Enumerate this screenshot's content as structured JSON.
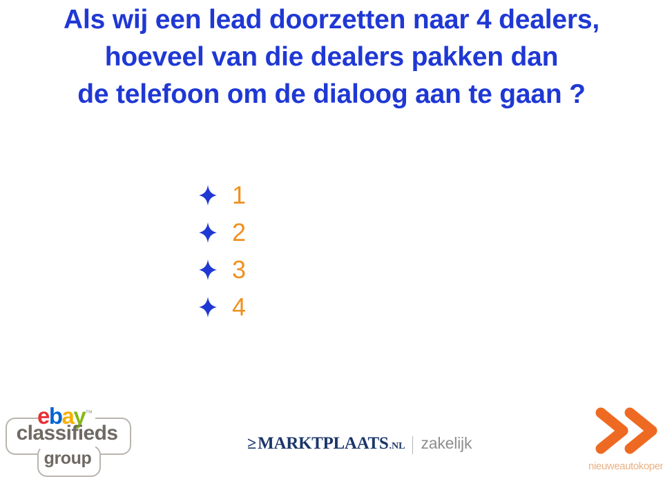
{
  "slide": {
    "background_color": "#ffffff",
    "title": {
      "color": "#1f38d4",
      "lines": [
        "Als wij een lead doorzetten naar 4 dealers,",
        "hoeveel van die dealers pakken dan",
        "de telefoon om de dialoog aan te gaan ?"
      ]
    },
    "bullets": {
      "marker_icon": "blue-four-point-star-bullet",
      "marker_color": "#1f38d4",
      "label_color": "#f0901f",
      "items": [
        {
          "label": "1"
        },
        {
          "label": "2"
        },
        {
          "label": "3"
        },
        {
          "label": "4"
        }
      ]
    },
    "footer": {
      "logos": [
        {
          "name": "ebay-classifieds-group",
          "ebay_letters": [
            {
              "char": "e",
              "color": "#e53238"
            },
            {
              "char": "b",
              "color": "#0064d2"
            },
            {
              "char": "a",
              "color": "#f5af02"
            },
            {
              "char": "y",
              "color": "#86b817"
            }
          ],
          "trademark": "™",
          "classifieds_text": "classifieds",
          "group_text": "group",
          "text_color": "#6e6a63",
          "outline_color": "#b9b5ad"
        },
        {
          "name": "marktplaats-zakelijk",
          "arrow_glyph": "≥",
          "wordmark": "MARKTPLAATS",
          "tld": ".NL",
          "separator": "|",
          "subtitle": "zakelijk",
          "wordmark_color": "#1b3668",
          "subtitle_color": "#8d8d8d"
        },
        {
          "name": "nieuweautokopen-nl",
          "icon": "double-chevron-right-icon",
          "icon_color": "#ee6a22",
          "caption": "nieuweautokopen.nl",
          "caption_color": "#eab184"
        }
      ]
    }
  }
}
